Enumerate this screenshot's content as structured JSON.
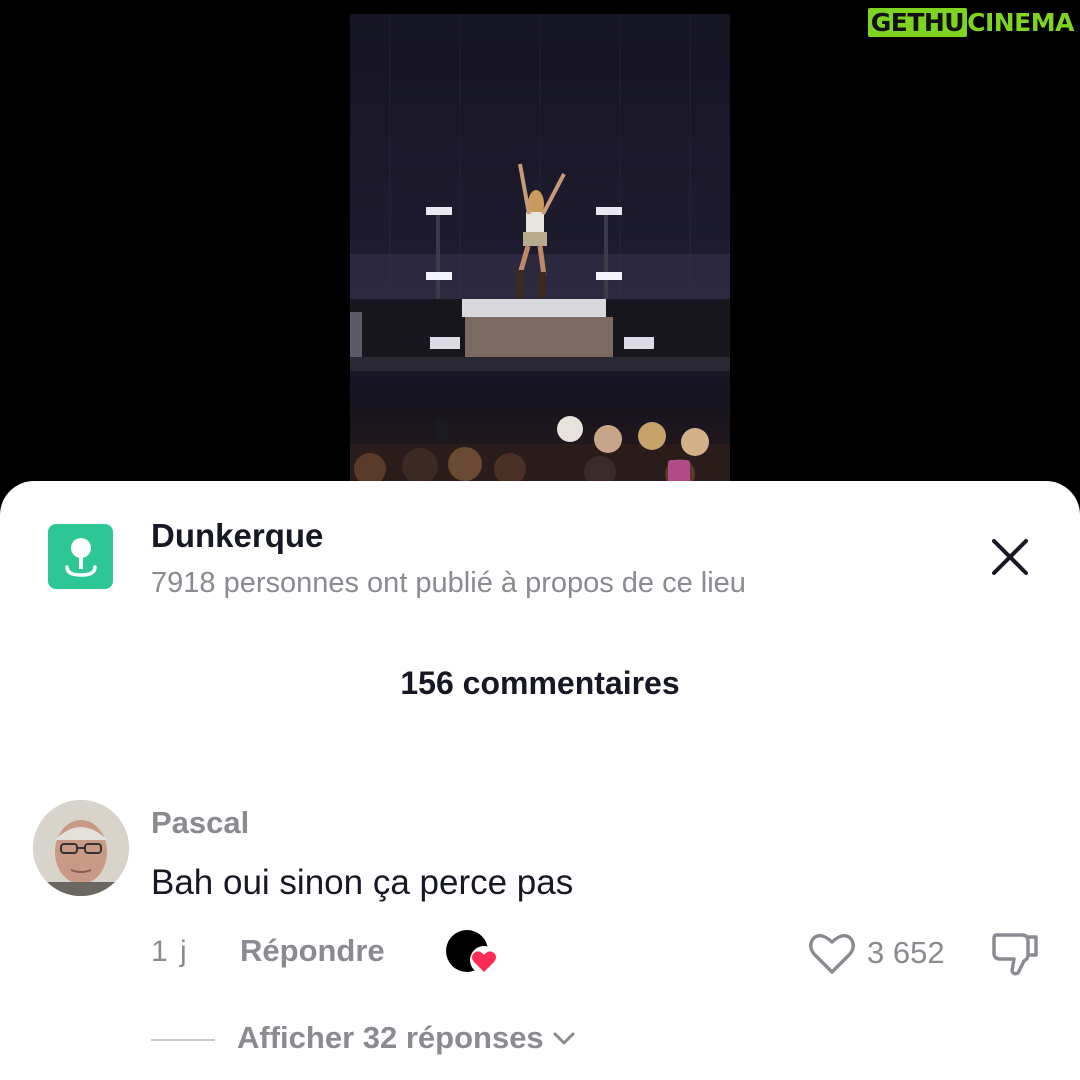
{
  "watermark": {
    "part1": "GETHU",
    "part2": "CINEMA"
  },
  "location": {
    "name": "Dunkerque",
    "subtitle": "7918 personnes ont publié à propos de ce lieu"
  },
  "comments_header": {
    "count_label": "156 commentaires"
  },
  "comment": {
    "author": "Pascal",
    "text": "Bah oui sinon ça perce pas",
    "time": "1 j",
    "reply_label": "Répondre",
    "like_count": "3 652",
    "view_replies_label": "Afficher 32 réponses"
  },
  "colors": {
    "location_icon_bg": "#2cc795",
    "creator_heart": "#fe2c55",
    "watermark": "#7fd321"
  },
  "icons": {
    "location": "location-pin-icon",
    "close": "close-icon",
    "like": "heart-outline-icon",
    "dislike": "thumbs-down-icon",
    "creator_like": "creator-liked-icon",
    "chevron": "chevron-down-icon"
  }
}
